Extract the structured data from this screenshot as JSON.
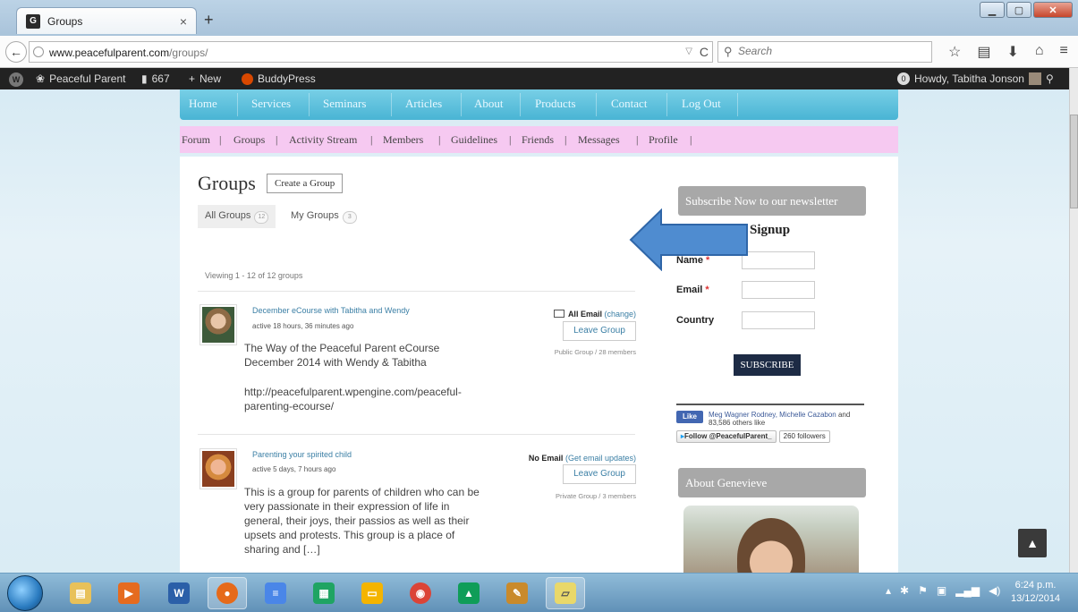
{
  "browser": {
    "tab_title": "Groups",
    "tab_favicon": "G",
    "tab_close": "×",
    "new_tab": "+",
    "url_host": "www.peacefulparent.com",
    "url_path": "/groups/",
    "search_placeholder": "Search"
  },
  "adminbar": {
    "site_name": "Peaceful Parent",
    "comments_count": "667",
    "new_label": "New",
    "buddypress_label": "BuddyPress",
    "notification_count": "0",
    "howdy": "Howdy, Tabitha Jonson"
  },
  "main_menu": [
    "Home",
    "Services",
    "Seminars",
    "Articles",
    "About",
    "Products",
    "Contact",
    "Log Out"
  ],
  "sub_menu": [
    "Forum",
    "|",
    "Groups",
    "|",
    "Activity Stream",
    "|",
    "Members",
    "|",
    "Guidelines",
    "|",
    "Friends",
    "|",
    "Messages",
    "|",
    "Profile",
    "|"
  ],
  "page": {
    "title": "Groups",
    "create_group": "Create a Group",
    "all_groups_label": "All Groups",
    "all_groups_count": "12",
    "my_groups_label": "My Groups",
    "my_groups_count": "3",
    "viewing": "Viewing 1 - 12 of 12 groups"
  },
  "groups": [
    {
      "name": "December eCourse with Tabitha and Wendy",
      "active": "active 18 hours, 36 minutes ago",
      "description_1": "The Way of the Peaceful Parent eCourse December 2014 with Wendy & Tabitha",
      "description_2": "http://peacefulparent.wpengine.com/peaceful-parenting-ecourse/",
      "email_status": "All Email",
      "email_action": "(change)",
      "leave": "Leave Group",
      "meta": "Public Group / 28 members"
    },
    {
      "name": "Parenting your spirited child",
      "active": "active 5 days, 7 hours ago",
      "description_1": "This is a group for parents of children who can be very passionate in their expression of life in general, their joys, their passios as well as their upsets and protests. This group is a place of sharing and […]",
      "email_status": "No Email",
      "email_action": "(Get email updates)",
      "leave": "Leave Group",
      "meta": "Private Group / 3 members"
    }
  ],
  "sidebar": {
    "newsletter_title": "Subscribe Now to our newsletter",
    "signup": "Signup",
    "name_label": "Name",
    "email_label": "Email",
    "country_label": "Country",
    "required_mark": "*",
    "subscribe_button": "SUBSCRIBE",
    "fb_like": "Like",
    "fb_names": "Meg Wagner Rodney, Michelle Cazabon",
    "fb_text": " and 83,586 others like",
    "twitter_follow": "Follow @PeacefulParent_",
    "twitter_followers": "260 followers",
    "about_title": "About Genevieve"
  },
  "taskbar": {
    "time": "6:24 p.m.",
    "date": "13/12/2014"
  },
  "colors": {
    "main_menu": "#49b4d4",
    "sub_menu": "#f6c9f1",
    "subscribe": "#1d2b45",
    "arrow": "#4f8cd0"
  }
}
